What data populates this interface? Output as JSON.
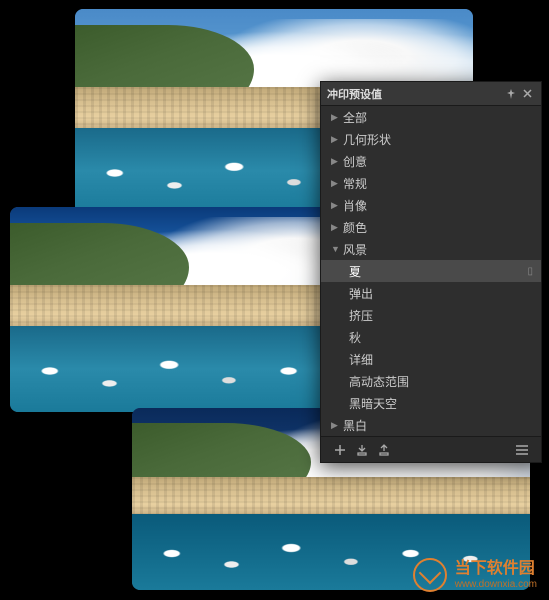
{
  "panel": {
    "title": "冲印预设值",
    "categories": [
      {
        "label": "全部",
        "expanded": false
      },
      {
        "label": "几何形状",
        "expanded": false
      },
      {
        "label": "创意",
        "expanded": false
      },
      {
        "label": "常规",
        "expanded": false
      },
      {
        "label": "肖像",
        "expanded": false
      },
      {
        "label": "颜色",
        "expanded": false
      },
      {
        "label": "风景",
        "expanded": true
      }
    ],
    "landscape_children": [
      {
        "label": "夏",
        "selected": true
      },
      {
        "label": "弹出",
        "selected": false
      },
      {
        "label": "挤压",
        "selected": false
      },
      {
        "label": "秋",
        "selected": false
      },
      {
        "label": "详细",
        "selected": false
      },
      {
        "label": "高动态范围",
        "selected": false
      },
      {
        "label": "黑暗天空",
        "selected": false
      }
    ],
    "last_category": {
      "label": "黑白",
      "expanded": false
    }
  },
  "watermark": {
    "name": "当下软件园",
    "url": "www.downxia.com"
  }
}
